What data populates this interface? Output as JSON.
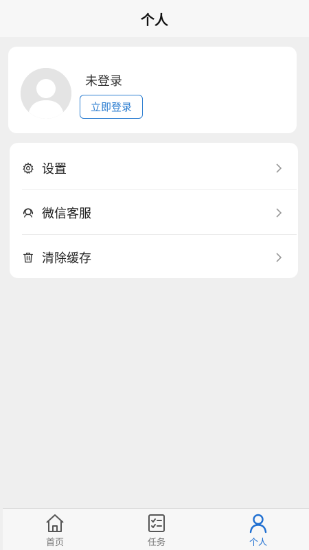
{
  "header": {
    "title": "个人"
  },
  "profile": {
    "status": "未登录",
    "login_button": "立即登录"
  },
  "menu": {
    "items": [
      {
        "label": "设置",
        "icon": "gear-icon"
      },
      {
        "label": "微信客服",
        "icon": "headset-icon"
      },
      {
        "label": "清除缓存",
        "icon": "trash-icon"
      }
    ]
  },
  "tabbar": {
    "items": [
      {
        "label": "首页",
        "icon": "home-icon"
      },
      {
        "label": "任务",
        "icon": "task-list-icon"
      },
      {
        "label": "个人",
        "icon": "person-icon",
        "active": true
      }
    ]
  },
  "colors": {
    "accent": "#1f6fd1",
    "border_button": "#2f7fd1"
  }
}
